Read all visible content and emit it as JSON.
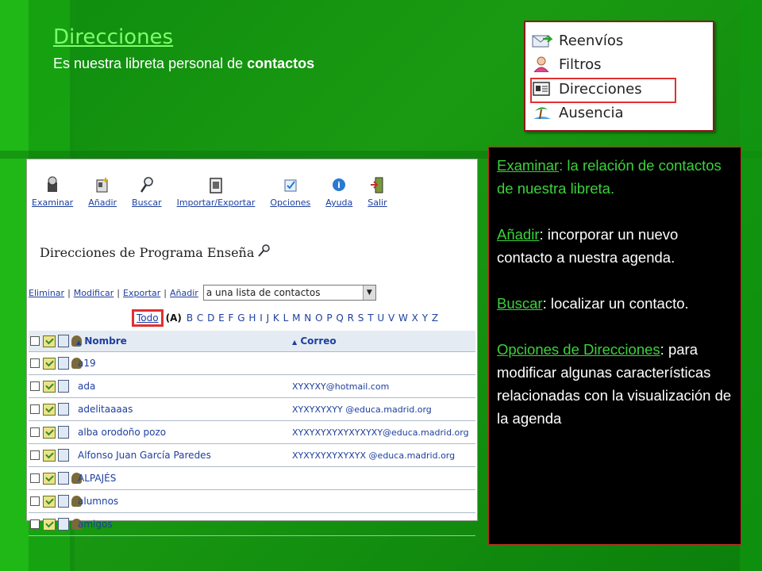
{
  "slide": {
    "title": "Direcciones",
    "subtitle_pre": "Es nuestra libreta personal de ",
    "subtitle_bold": "contactos"
  },
  "menu_inset": {
    "items": [
      {
        "label": "Reenvíos",
        "icon": "forward-mail-icon"
      },
      {
        "label": "Filtros",
        "icon": "person-filter-icon"
      },
      {
        "label": "Direcciones",
        "icon": "address-book-icon",
        "highlighted": true
      },
      {
        "label": "Ausencia",
        "icon": "beach-icon"
      }
    ]
  },
  "webmail": {
    "toolbar": [
      {
        "label": "Examinar",
        "icon": "examine-icon"
      },
      {
        "label": "Añadir",
        "icon": "add-contact-icon"
      },
      {
        "label": "Buscar",
        "icon": "search-icon"
      },
      {
        "label": "Importar/Exportar",
        "icon": "import-export-icon"
      },
      {
        "label": "Opciones",
        "icon": "options-icon"
      },
      {
        "label": "Ayuda",
        "icon": "help-icon"
      },
      {
        "label": "Salir",
        "icon": "exit-icon"
      }
    ],
    "page_title": "Direcciones de Programa Enseña",
    "actions": {
      "eliminar": "Eliminar",
      "modificar": "Modificar",
      "exportar": "Exportar",
      "anadir": "Añadir",
      "select_value": "a una lista de contactos"
    },
    "alphabet": {
      "todo": "Todo",
      "current": "(A)",
      "letters": "B C D E F G H I J K L M N O P Q R S T U V W X Y Z"
    },
    "table": {
      "headers": {
        "name": "Nombre",
        "email": "Correo",
        "sort_glyph": "▲"
      },
      "rows": [
        {
          "name": "a19",
          "email": ""
        },
        {
          "name": "ada",
          "email": "XYXYXY@hotmail.com"
        },
        {
          "name": "adelitaaaas",
          "email": "XYXYXYXYY @educa.madrid.org"
        },
        {
          "name": "alba orodoño pozo",
          "email": "XYXYXYXYXYXYXYXY@educa.madrid.org"
        },
        {
          "name": "Alfonso Juan García Paredes",
          "email": "XYXYXYXYXYXYX @educa.madrid.org"
        },
        {
          "name": "ALPAJÉS",
          "email": ""
        },
        {
          "name": "alumnos",
          "email": ""
        },
        {
          "name": "amigos",
          "email": ""
        }
      ]
    }
  },
  "info": {
    "examinar_term": "Examinar",
    "examinar_desc": ": la relación de contactos de nuestra libreta.",
    "anadir_term": "Añadir",
    "anadir_desc": ": incorporar un nuevo contacto a nuestra agenda.",
    "buscar_term": "Buscar",
    "buscar_desc": ": localizar un contacto.",
    "opciones_term": "Opciones de Direcciones",
    "opciones_desc": ": para modificar algunas características relacionadas con la visualización de la agenda"
  }
}
